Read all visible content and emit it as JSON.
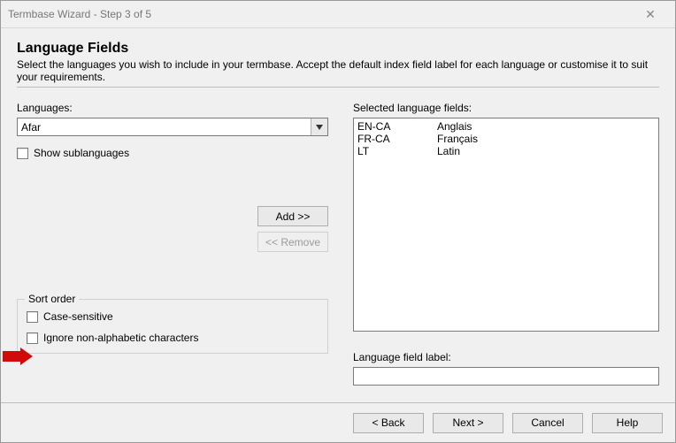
{
  "window": {
    "title": "Termbase Wizard - Step 3 of 5"
  },
  "page": {
    "heading": "Language Fields",
    "subheading": "Select the languages you wish to include in your termbase. Accept the default index field label for each language or customise it to suit your requirements."
  },
  "left": {
    "languages_label": "Languages:",
    "language_value": "Afar",
    "show_sub": "Show sublanguages",
    "add": "Add >>",
    "remove": "<< Remove",
    "sort": {
      "legend": "Sort order",
      "case": "Case-sensitive",
      "ignore": "Ignore non-alphabetic characters"
    }
  },
  "right": {
    "selected_label": "Selected language fields:",
    "rows": [
      {
        "code": "EN-CA",
        "name": "Anglais"
      },
      {
        "code": "FR-CA",
        "name": "Français"
      },
      {
        "code": "LT",
        "name": "Latin"
      }
    ],
    "lf_label": "Language field label:",
    "lf_value": ""
  },
  "footer": {
    "back": "< Back",
    "next": "Next >",
    "cancel": "Cancel",
    "help": "Help"
  }
}
